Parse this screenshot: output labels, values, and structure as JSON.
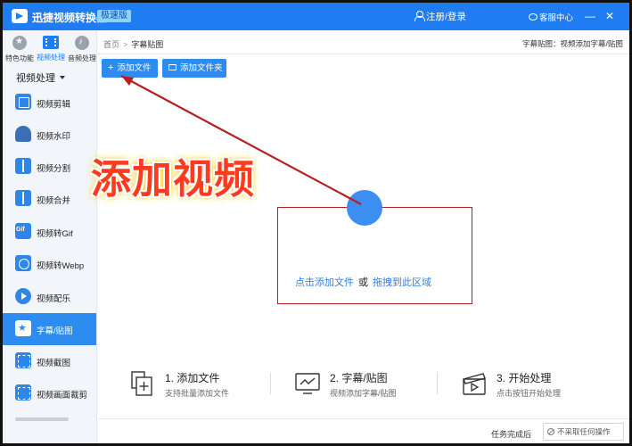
{
  "titlebar": {
    "app_title": "迅捷视频转换器",
    "edition_badge": "极速版",
    "login_label": "注册/登录",
    "service_label": "客服中心",
    "minimize_glyph": "—",
    "close_glyph": "✕"
  },
  "sidebar": {
    "categories": [
      {
        "label": "特色功能",
        "icon": "star-icon"
      },
      {
        "label": "视频处理",
        "icon": "film-icon",
        "active": true
      },
      {
        "label": "音频处理",
        "icon": "music-icon"
      }
    ],
    "section_label": "视频处理",
    "items": [
      {
        "label": "视频剪辑",
        "icon": "edit-icon"
      },
      {
        "label": "视频水印",
        "icon": "watermark-icon"
      },
      {
        "label": "视频分割",
        "icon": "split-icon"
      },
      {
        "label": "视频合并",
        "icon": "merge-icon"
      },
      {
        "label": "视频转Gif",
        "icon": "gif-icon"
      },
      {
        "label": "视频转Webp",
        "icon": "webp-icon"
      },
      {
        "label": "视频配乐",
        "icon": "audio-icon"
      },
      {
        "label": "字幕/贴图",
        "icon": "subtitle-icon",
        "active": true
      },
      {
        "label": "视频截图",
        "icon": "screenshot-icon"
      },
      {
        "label": "视频画面裁剪",
        "icon": "crop-icon"
      }
    ]
  },
  "breadcrumb": {
    "home": "首页",
    "separator": ">",
    "current": "字幕贴图"
  },
  "header_note": "字幕贴图：视频添加字幕/贴图",
  "toolbar": {
    "add_file_label": "添加文件",
    "add_folder_label": "添加文件夹"
  },
  "annotation": {
    "text": "添加视频",
    "color": "#ff3b1f",
    "arrow_color": "#b51f1f"
  },
  "drop_zone": {
    "link_add": "点击添加文件",
    "or": "或",
    "link_drag": "拖拽到此区域"
  },
  "steps": [
    {
      "title": "1. 添加文件",
      "desc": "支持批量添加文件",
      "icon": "add-file-icon"
    },
    {
      "title": "2. 字幕/贴图",
      "desc": "视频添加字幕/贴图",
      "icon": "monitor-icon"
    },
    {
      "title": "3. 开始处理",
      "desc": "点击按钮开始处理",
      "icon": "clapperboard-icon"
    }
  ],
  "status_bar": {
    "task_done_label": "任务完成后",
    "after_action_value": "不采取任何操作"
  },
  "colors": {
    "brand": "#1f7cf2",
    "accent": "#2d8cf0",
    "sidebar_bg": "#f2f5fa"
  }
}
